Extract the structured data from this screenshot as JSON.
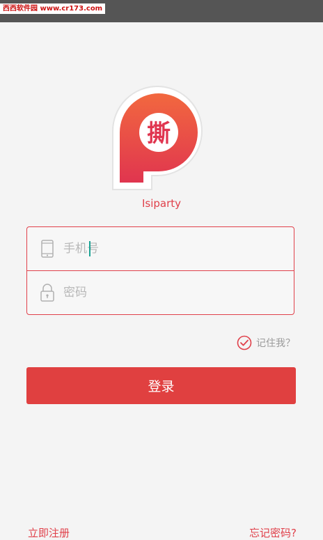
{
  "watermark": "西西软件园 www.cr173.com",
  "logo": {
    "glyph": "撕",
    "brand_colors": [
      "#f2683f",
      "#e0354f"
    ]
  },
  "app_name": "Isiparty",
  "form": {
    "phone_placeholder": "手机号",
    "password_placeholder": "密码"
  },
  "remember": {
    "label": "记住我？",
    "checked": true
  },
  "login_button_label": "登录",
  "footer": {
    "register_label": "立即注册",
    "forgot_label": "忘记密码?"
  },
  "icons": [
    "phone-icon",
    "lock-icon",
    "check-circle-icon"
  ],
  "colors": {
    "accent": "#e0404a",
    "button": "#e04040",
    "caret": "#1aa394",
    "background": "#f4f4f4"
  }
}
